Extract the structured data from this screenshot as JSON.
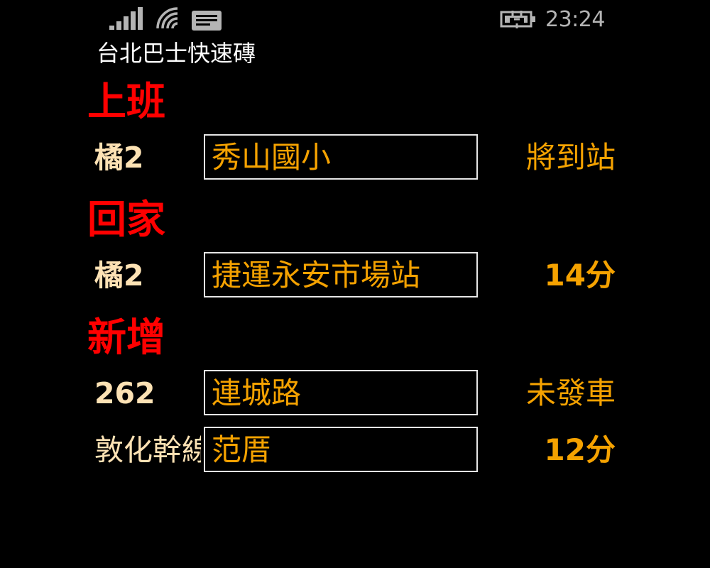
{
  "status_bar": {
    "time": "23:24",
    "icons": [
      "signal-icon",
      "wifi-icon",
      "message-icon",
      "battery-charging-icon"
    ],
    "colors": {
      "icon": "#b4b4b4",
      "text": "#b4b4b4"
    }
  },
  "app": {
    "title": "台北巴士快速磚"
  },
  "sections": [
    {
      "title": "上班",
      "rows": [
        {
          "route": "橘2",
          "stop": "秀山國小",
          "arrival": "將到站"
        }
      ]
    },
    {
      "title": "回家",
      "rows": [
        {
          "route": "橘2",
          "stop": "捷運永安市場站",
          "arrival": "14分"
        }
      ]
    },
    {
      "title": "新增",
      "rows": [
        {
          "route": "262",
          "stop": "連城路",
          "arrival": "未發車"
        },
        {
          "route": "敦化幹線",
          "stop": "范厝",
          "arrival": "12分"
        }
      ]
    }
  ],
  "colors": {
    "background": "#000000",
    "section_title": "#ff0000",
    "route_text": "#fde2b4",
    "stop_text": "#f5a200",
    "arrival_text": "#f5a200",
    "box_border": "#e6e6e6"
  }
}
